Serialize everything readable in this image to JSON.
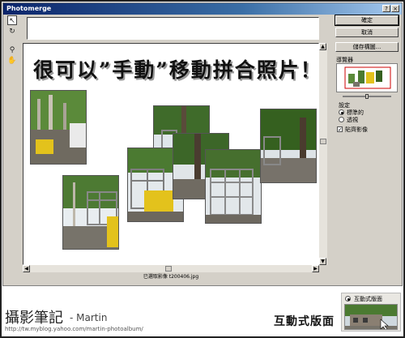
{
  "window": {
    "title": "Photomerge"
  },
  "toolbar_tools": {
    "select": "select-image-tool",
    "rotate": "rotate-image-tool",
    "zoom": "zoom-tool",
    "hand": "hand-tool"
  },
  "canvas": {
    "headline": "很可以”手動”移動拼合照片！",
    "status": "已選取影像 t200406.jpg"
  },
  "panel": {
    "ok_label": "確定",
    "cancel_label": "取消",
    "save_label": "儲存構圖...",
    "navigator_label": "導覽器",
    "settings_label": "設定",
    "option_normal": "標準的",
    "option_perspective": "透視",
    "option_snap": "貼齊影像",
    "selected_option": "option_normal",
    "snap_checked": true
  },
  "caption": {
    "brand": "攝影筆記",
    "author": "- Martin",
    "url": "http://tw.myblog.yahoo.com/martin-photoalbum/",
    "feature": "互動式版面",
    "mini_option": "互動式版面"
  },
  "colors": {
    "title_bar": "#0a246a",
    "window_bg": "#d4d0c8",
    "foliage": "#3f6b2a",
    "sky": "#dfe6ea",
    "yellow_board": "#e3c21c"
  }
}
